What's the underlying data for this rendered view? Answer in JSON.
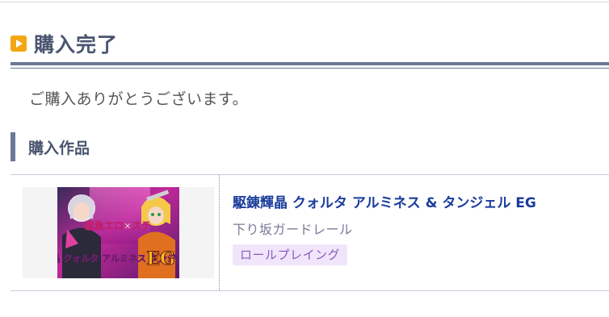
{
  "page": {
    "heading": "購入完了",
    "thanks_message": "ご購入ありがとうございます。"
  },
  "section": {
    "title": "購入作品"
  },
  "product": {
    "title": "駆錬輝晶 クォルタ アルミネス & タンジェル EG",
    "maker": "下り坂ガードレール",
    "genre": "ロールプレイング",
    "thumbnail_logo": "駆錬輝晶 クォルタ アルミネス タンジェル EG",
    "thumbnail_banner": "緊急エロ×ステ"
  },
  "colors": {
    "heading_text": "#4a5670",
    "rule": "#6b7896",
    "icon_accent": "#f3a713",
    "link": "#1a3c9c",
    "maker_text": "#7a7a9a",
    "badge_bg": "#f1e5fb",
    "badge_text": "#8a5bb8"
  },
  "icons": {
    "heading_icon": "play-icon"
  }
}
